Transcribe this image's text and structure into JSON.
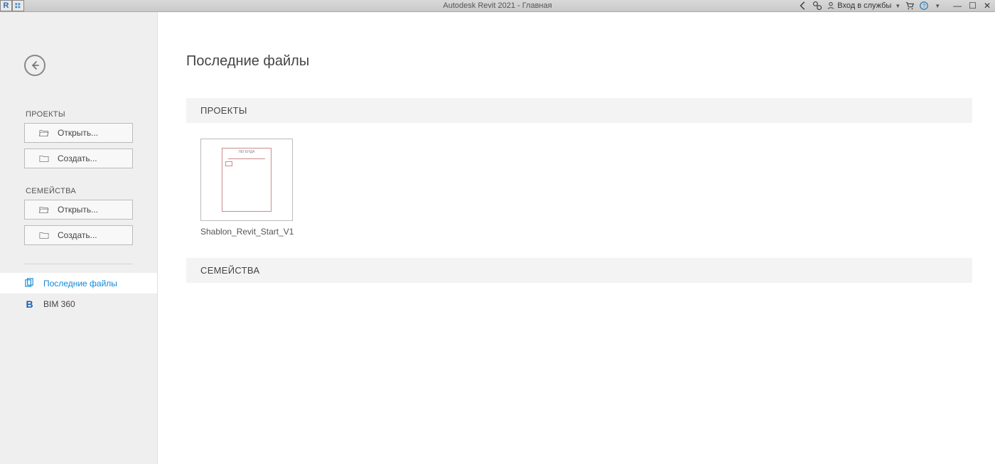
{
  "titlebar": {
    "app_title": "Autodesk Revit 2021 - Главная",
    "signin_label": "Вход в службы"
  },
  "sidebar": {
    "projects_label": "ПРОЕКТЫ",
    "families_label": "СЕМЕЙСТВА",
    "open_label": "Открыть...",
    "create_label": "Создать...",
    "nav": {
      "recent_label": "Последние файлы",
      "bim360_label": "BIM 360"
    }
  },
  "main": {
    "title": "Последние файлы",
    "projects_head": "ПРОЕКТЫ",
    "families_head": "СЕМЕЙСТВА",
    "recent_files": [
      {
        "name": "Shablon_Revit_Start_V1",
        "preview_caption": "ЛЕГЕНДА"
      }
    ]
  }
}
